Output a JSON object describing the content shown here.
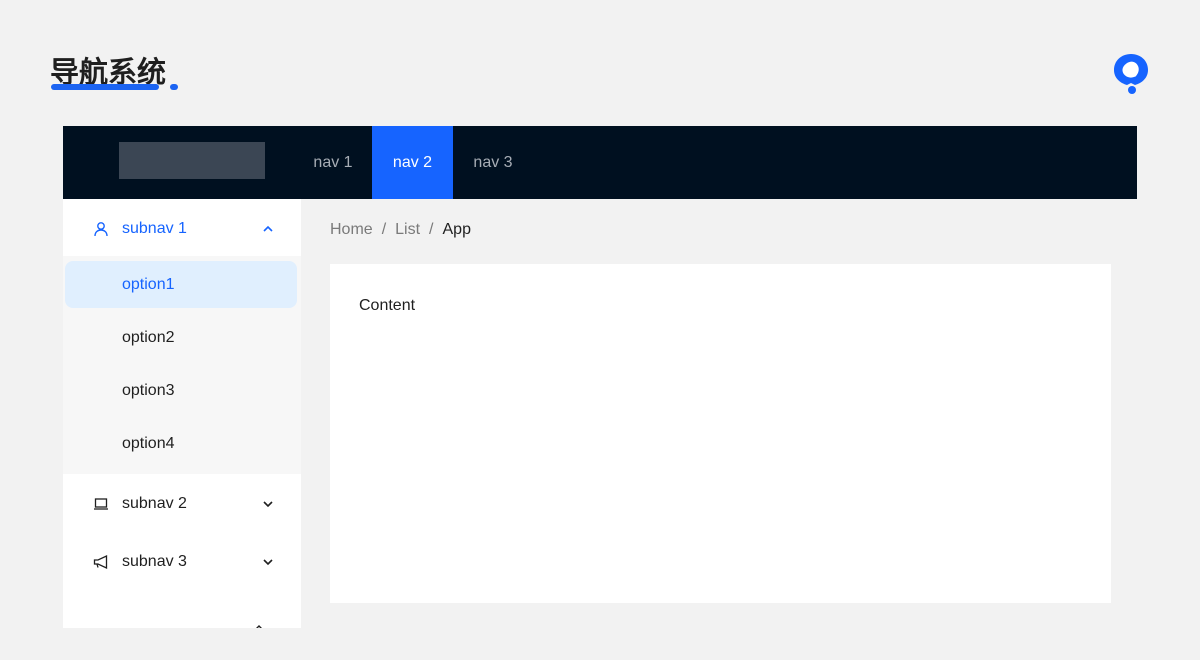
{
  "page": {
    "title": "导航系统"
  },
  "header": {
    "nav": [
      {
        "label": "nav 1",
        "active": false
      },
      {
        "label": "nav 2",
        "active": true
      },
      {
        "label": "nav 3",
        "active": false
      }
    ]
  },
  "sidebar": {
    "submenus": [
      {
        "label": "subnav 1",
        "icon": "user-icon",
        "expanded": true,
        "options": [
          {
            "label": "option1",
            "selected": true
          },
          {
            "label": "option2",
            "selected": false
          },
          {
            "label": "option3",
            "selected": false
          },
          {
            "label": "option4",
            "selected": false
          }
        ]
      },
      {
        "label": "subnav 2",
        "icon": "laptop-icon",
        "expanded": false
      },
      {
        "label": "subnav 3",
        "icon": "notification-icon",
        "expanded": false
      }
    ]
  },
  "breadcrumb": {
    "items": [
      "Home",
      "List",
      "App"
    ],
    "separator": "/"
  },
  "content": {
    "text": "Content"
  },
  "colors": {
    "accent": "#1664ff",
    "header_bg": "#001020",
    "selected_bg": "#e0effe",
    "page_bg": "#f2f2f2"
  }
}
